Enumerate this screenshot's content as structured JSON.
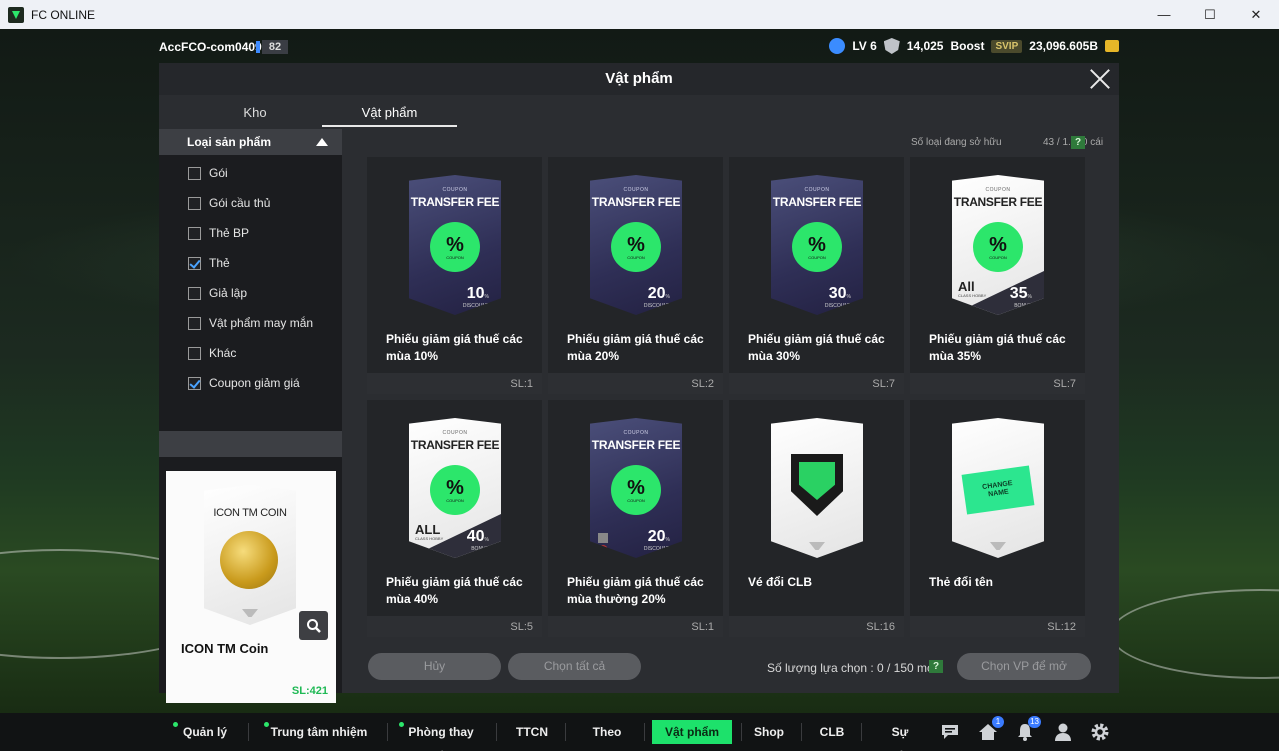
{
  "window": {
    "title": "FC ONLINE",
    "controls": [
      "minimize",
      "maximize",
      "close"
    ]
  },
  "account": {
    "name": "AccFCO-com0409i",
    "level_badge": "82"
  },
  "stats": {
    "level": "LV 6",
    "points": "14,025",
    "boost_label": "Boost",
    "boost_tier": "SVIP",
    "balance": "23,096.605B"
  },
  "modal": {
    "title": "Vật phẩm",
    "tabs": [
      {
        "label": "Kho",
        "active": false
      },
      {
        "label": "Vật phẩm",
        "active": true
      }
    ],
    "category_header": "Loại sản phẩm",
    "categories": [
      {
        "label": "Gói",
        "checked": false
      },
      {
        "label": "Gói cầu thủ",
        "checked": false
      },
      {
        "label": "Thẻ BP",
        "checked": false
      },
      {
        "label": "Thẻ",
        "checked": true
      },
      {
        "label": "Giả lập",
        "checked": false
      },
      {
        "label": "Vật phẩm may mắn",
        "checked": false
      },
      {
        "label": "Khác",
        "checked": false
      },
      {
        "label": "Coupon giảm giá",
        "checked": true
      }
    ],
    "preview": {
      "card_title": "ICON TM COIN",
      "name": "ICON TM Coin",
      "qty": "SL:421"
    },
    "owned_label": "Số loại đang sở hữu",
    "owned_value": "43 / 1.000 cái",
    "help": "?",
    "items": [
      {
        "name": "Phiếu giảm giá thuế các mùa 10%",
        "qty": "SL:1",
        "coupon": "COUPON",
        "title": "TRANSFER FEE",
        "value": "10",
        "unit": "%",
        "caption": "DISCOUNT"
      },
      {
        "name": "Phiếu giảm giá thuế các mùa 20%",
        "qty": "SL:2",
        "coupon": "COUPON",
        "title": "TRANSFER FEE",
        "value": "20",
        "unit": "%",
        "caption": "DISCOUNT"
      },
      {
        "name": "Phiếu giảm giá thuế các mùa 30%",
        "qty": "SL:7",
        "coupon": "COUPON",
        "title": "TRANSFER FEE",
        "value": "30",
        "unit": "%",
        "caption": "DISCOUNT"
      },
      {
        "name": "Phiếu giảm giá thuế các mùa 35%",
        "qty": "SL:7",
        "coupon": "COUPON",
        "title": "TRANSFER FEE",
        "value": "35",
        "unit": "%",
        "caption": "BONUS",
        "all_label": "All",
        "all_caption": "CLASS HOBBY"
      },
      {
        "name": "Phiếu giảm giá thuế các mùa 40%",
        "qty": "SL:5",
        "coupon": "COUPON",
        "title": "TRANSFER FEE",
        "value": "40",
        "unit": "%",
        "caption": "BONUS",
        "all_label": "ALL",
        "all_caption": "CLASS HOBBY"
      },
      {
        "name": "Phiếu giảm giá thuế các mùa thường 20%",
        "qty": "SL:1",
        "coupon": "COUPON",
        "title": "TRANSFER FEE",
        "value": "20",
        "unit": "%",
        "caption": "DISCOUNT"
      },
      {
        "name": "Vé đổi CLB",
        "qty": "SL:16"
      },
      {
        "name": "Thẻ đổi tên",
        "qty": "SL:12",
        "ticket_text_1": "CHANGE",
        "ticket_text_2": "NAME"
      }
    ],
    "badge": {
      "symbol": "%",
      "text": "COUPON"
    },
    "buttons": {
      "cancel": "Hủy",
      "select_all": "Chọn tất cả",
      "pick": "Chọn VP để mở"
    },
    "selection_count": "Số lượng lựa chọn : 0 / 150 món"
  },
  "nav": [
    {
      "label": "Quản lý CT",
      "dot": true,
      "active": false
    },
    {
      "label": "Trung tâm nhiệm vụ",
      "dot": true,
      "active": false
    },
    {
      "label": "Phòng thay đồ",
      "dot": true,
      "active": false
    },
    {
      "label": "TTCN",
      "dot": false,
      "active": false
    },
    {
      "label": "Theo dõi",
      "dot": false,
      "active": false
    },
    {
      "label": "Vật phẩm",
      "dot": false,
      "active": true
    },
    {
      "label": "Shop",
      "dot": false,
      "active": false
    },
    {
      "label": "CLB",
      "dot": false,
      "active": false
    },
    {
      "label": "Sự kiện",
      "dot": false,
      "active": false
    }
  ],
  "nav_icons": [
    {
      "icon": "chat-icon"
    },
    {
      "icon": "home-icon",
      "badge": "1"
    },
    {
      "icon": "bell-icon",
      "badge": "13"
    },
    {
      "icon": "profile-icon"
    },
    {
      "icon": "settings-icon"
    }
  ],
  "colors": {
    "accent": "#1de16b",
    "badge_green": "#2ce66b",
    "qty_green": "#1fb955"
  }
}
